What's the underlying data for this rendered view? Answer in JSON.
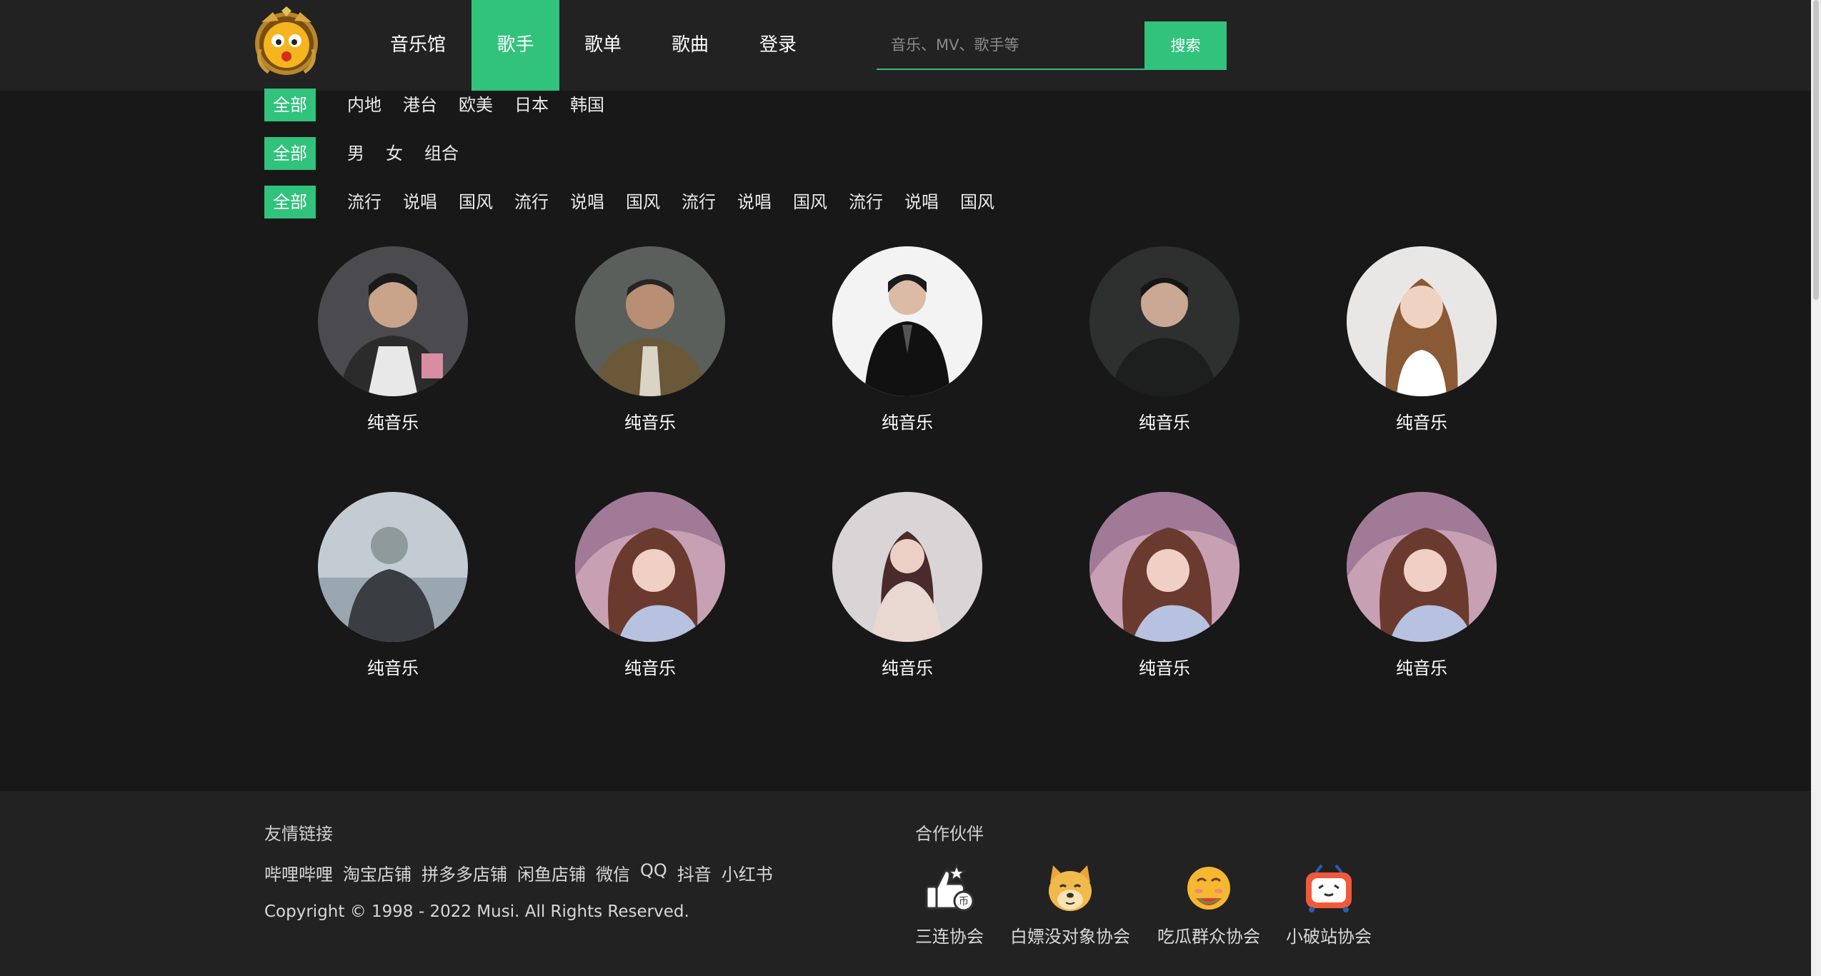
{
  "header": {
    "nav": [
      "音乐馆",
      "歌手",
      "歌单",
      "歌曲",
      "登录"
    ],
    "active_nav": "歌手",
    "search_placeholder": "音乐、MV、歌手等",
    "search_button": "搜索"
  },
  "filters": {
    "all_label": "全部",
    "region": [
      "内地",
      "港台",
      "欧美",
      "日本",
      "韩国"
    ],
    "gender": [
      "男",
      "女",
      "组合"
    ],
    "genre": [
      "流行",
      "说唱",
      "国风",
      "流行",
      "说唱",
      "国风",
      "流行",
      "说唱",
      "国风",
      "流行",
      "说唱",
      "国风"
    ]
  },
  "singers": [
    {
      "name": "纯音乐"
    },
    {
      "name": "纯音乐"
    },
    {
      "name": "纯音乐"
    },
    {
      "name": "纯音乐"
    },
    {
      "name": "纯音乐"
    },
    {
      "name": "纯音乐"
    },
    {
      "name": "纯音乐"
    },
    {
      "name": "纯音乐"
    },
    {
      "name": "纯音乐"
    },
    {
      "name": "纯音乐"
    }
  ],
  "footer": {
    "links_title": "友情链接",
    "links": [
      "哔哩哔哩",
      "淘宝店铺",
      "拼多多店铺",
      "闲鱼店铺",
      "微信",
      "QQ",
      "抖音",
      "小红书"
    ],
    "copyright": "Copyright © 1998 - 2022 Musi. All Rights Reserved.",
    "partners_title": "合作伙伴",
    "partners": [
      {
        "label": "三连协会",
        "icon": "triple-like-icon"
      },
      {
        "label": "白嫖没对象协会",
        "icon": "doge-icon"
      },
      {
        "label": "吃瓜群众协会",
        "icon": "melon-emoji-icon"
      },
      {
        "label": "小破站协会",
        "icon": "bilibili-tv-icon"
      }
    ]
  },
  "colors": {
    "accent": "#31c27c",
    "background": "#181818",
    "header_bg": "#222222"
  }
}
